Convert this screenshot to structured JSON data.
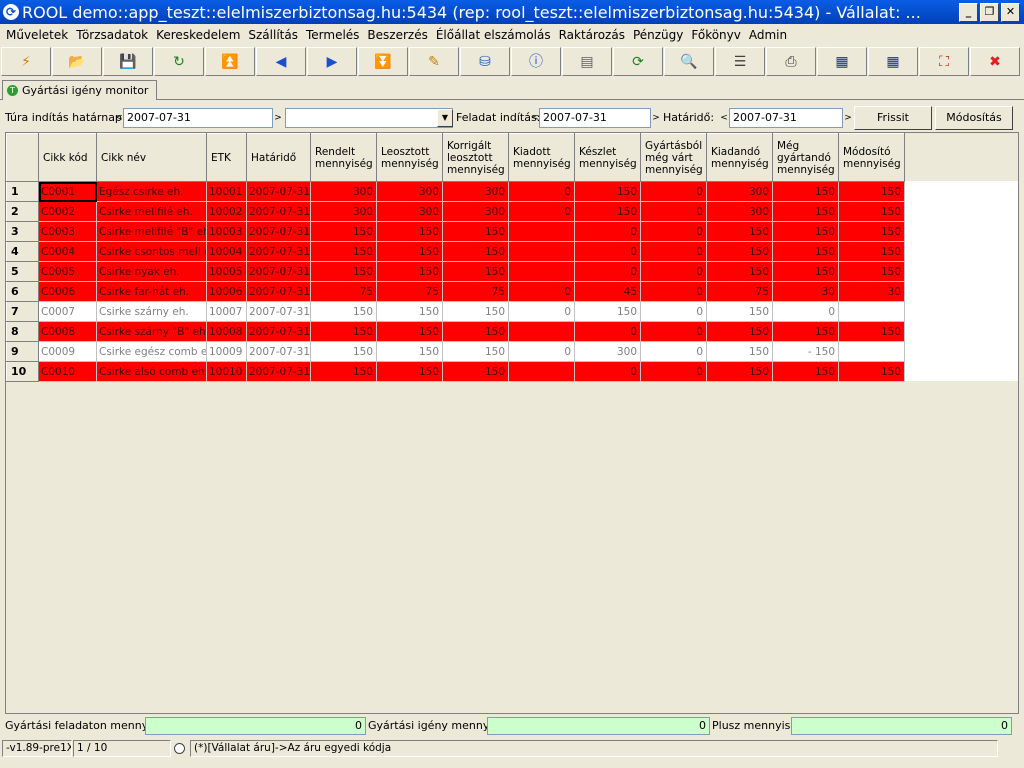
{
  "window": {
    "title": "ROOL demo::app_teszt::elelmiszerbiztonsag.hu:5434 (rep: rool_teszt::elelmiszerbiztonsag.hu:5434) - Vállalat: ...",
    "minimize": "_",
    "restore": "❐",
    "close": "✕"
  },
  "menu": [
    "Műveletek",
    "Törzsadatok",
    "Kereskedelem",
    "Szállítás",
    "Termelés",
    "Beszerzés",
    "Élőállat elszámolás",
    "Raktározás",
    "Pénzügy",
    "Főkönyv",
    "Admin"
  ],
  "toolbar": [
    {
      "icon": "lightning-icon",
      "glyph": "⚡",
      "color": "#d08000"
    },
    {
      "icon": "open-folder-icon",
      "glyph": "📂",
      "color": "#2060c0"
    },
    {
      "icon": "save-icon",
      "glyph": "💾",
      "color": "#203060"
    },
    {
      "icon": "refresh-arrow-icon",
      "glyph": "↻",
      "color": "#208020"
    },
    {
      "icon": "first-record-icon",
      "glyph": "⏫",
      "color": "#1a4fd0"
    },
    {
      "icon": "previous-record-icon",
      "glyph": "◀",
      "color": "#1a4fd0"
    },
    {
      "icon": "next-record-icon",
      "glyph": "▶",
      "color": "#1a4fd0"
    },
    {
      "icon": "last-record-icon",
      "glyph": "⏬",
      "color": "#1a4fd0"
    },
    {
      "icon": "edit-icon",
      "glyph": "✎",
      "color": "#c08000"
    },
    {
      "icon": "database-icon",
      "glyph": "⛁",
      "color": "#2060c0"
    },
    {
      "icon": "info-icon",
      "glyph": "ⓘ",
      "color": "#1a4fd0"
    },
    {
      "icon": "form-view-icon",
      "glyph": "▤",
      "color": "#606060"
    },
    {
      "icon": "reload-icon",
      "glyph": "⟳",
      "color": "#208020"
    },
    {
      "icon": "search-icon",
      "glyph": "🔍",
      "color": "#404040"
    },
    {
      "icon": "row-height-icon",
      "glyph": "☰",
      "color": "#404040"
    },
    {
      "icon": "printer-icon",
      "glyph": "⎙",
      "color": "#404040"
    },
    {
      "icon": "grid-export-icon",
      "glyph": "▦",
      "color": "#203080"
    },
    {
      "icon": "grid-import-icon",
      "glyph": "▦",
      "color": "#203080"
    },
    {
      "icon": "fullscreen-icon",
      "glyph": "⛶",
      "color": "#c02020"
    },
    {
      "icon": "exit-icon",
      "glyph": "✖",
      "color": "#e02020"
    }
  ],
  "tab": {
    "label": "Gyártási igény monitor",
    "icon": "tab-green-icon",
    "icon_glyph": "T"
  },
  "filters": {
    "tura_label": "Túra indítás határnap:",
    "tura_value": "2007-07-31",
    "combo_value": "",
    "feladat_label": "Feladat indítás:",
    "feladat_value": "2007-07-31",
    "hatarido_label": "Határidő:",
    "hatarido_value": "2007-07-31",
    "left_arrow": "<",
    "right_arrow": ">",
    "combo_arrow": "▼",
    "refresh_button": "Frissit",
    "modify_button": "Módosítás"
  },
  "grid": {
    "columns": [
      {
        "label": "Cikk kód",
        "num": false
      },
      {
        "label": "Cikk név",
        "num": false
      },
      {
        "label": "ETK",
        "num": false
      },
      {
        "label": "Határidő",
        "num": false
      },
      {
        "label": "Rendelt\nmennyiség",
        "num": true
      },
      {
        "label": "Leosztott\nmennyiség",
        "num": true
      },
      {
        "label": "Korrigált\nleosztott\nmennyiség",
        "num": true
      },
      {
        "label": "Kiadott\nmennyiség",
        "num": true
      },
      {
        "label": "Készlet\nmennyiség",
        "num": true
      },
      {
        "label": "Gyártásból\nmég várt\nmennyiség",
        "num": true
      },
      {
        "label": "Kiadandó\nmennyiség",
        "num": true
      },
      {
        "label": "Még\ngyártandó\nmennyiség",
        "num": true
      },
      {
        "label": "Módosító\nmennyiség",
        "num": true
      }
    ],
    "rows": [
      {
        "n": "1",
        "style": "red",
        "cells": [
          "C0001",
          "Egész csirke eh.",
          "10001",
          "2007-07-31",
          "300",
          "300",
          "300",
          "0",
          "150",
          "0",
          "300",
          "150",
          "150"
        ]
      },
      {
        "n": "2",
        "style": "red",
        "cells": [
          "C0002",
          "Csirke mellfilé eh.",
          "10002",
          "2007-07-31",
          "300",
          "300",
          "300",
          "0",
          "150",
          "0",
          "300",
          "150",
          "150"
        ]
      },
      {
        "n": "3",
        "style": "red",
        "cells": [
          "C0003",
          "Csirke mellfilé \"B\" eh.",
          "10003",
          "2007-07-31",
          "150",
          "150",
          "150",
          "",
          "0",
          "0",
          "150",
          "150",
          "150"
        ]
      },
      {
        "n": "4",
        "style": "red",
        "cells": [
          "C0004",
          "Csirke csontos mell eh.",
          "10004",
          "2007-07-31",
          "150",
          "150",
          "150",
          "",
          "0",
          "0",
          "150",
          "150",
          "150"
        ]
      },
      {
        "n": "5",
        "style": "red",
        "cells": [
          "C0005",
          "Csirke nyak eh.",
          "10005",
          "2007-07-31",
          "150",
          "150",
          "150",
          "",
          "0",
          "0",
          "150",
          "150",
          "150"
        ]
      },
      {
        "n": "6",
        "style": "red",
        "cells": [
          "C0006",
          "Csirke far-hát eh.",
          "10006",
          "2007-07-31",
          "75",
          "75",
          "75",
          "0",
          "45",
          "0",
          "75",
          "30",
          "30"
        ]
      },
      {
        "n": "7",
        "style": "white",
        "cells": [
          "C0007",
          "Csirke szárny eh.",
          "10007",
          "2007-07-31",
          "150",
          "150",
          "150",
          "0",
          "150",
          "0",
          "150",
          "0",
          ""
        ]
      },
      {
        "n": "8",
        "style": "red",
        "cells": [
          "C0008",
          "Csirke szárny \"B\" eh.",
          "10008",
          "2007-07-31",
          "150",
          "150",
          "150",
          "",
          "0",
          "0",
          "150",
          "150",
          "150"
        ]
      },
      {
        "n": "9",
        "style": "white",
        "cells": [
          "C0009",
          "Csirke egész comb eh.",
          "10009",
          "2007-07-31",
          "150",
          "150",
          "150",
          "0",
          "300",
          "0",
          "150",
          "- 150",
          ""
        ]
      },
      {
        "n": "10",
        "style": "red",
        "cells": [
          "C0010",
          "Csirke alsó comb eh.",
          "10010",
          "2007-07-31",
          "150",
          "150",
          "150",
          "",
          "0",
          "0",
          "150",
          "150",
          "150"
        ]
      }
    ]
  },
  "summary": {
    "feladat_label": "Gyártási feladaton mennyiség",
    "feladat_value": "0",
    "igeny_label": "Gyártási igény mennyiség",
    "igeny_value": "0",
    "plusz_label": "Plusz mennyiség",
    "plusz_value": "0"
  },
  "status": {
    "version": "-v1.89-pre1X",
    "record": "1 / 10",
    "hint": "(*)[Vállalat áru]->Az áru egyedi kódja"
  },
  "colors": {
    "row_highlight": "#ff0000",
    "summary_field": "#ccffcc",
    "titlebar": "#0a5de6"
  }
}
